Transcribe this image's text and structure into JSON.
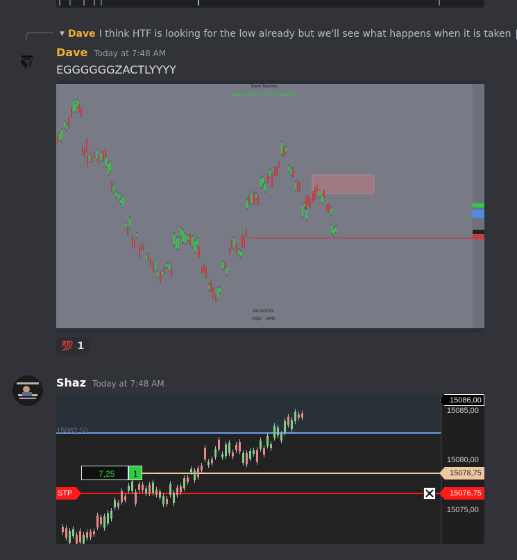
{
  "reply": {
    "author": "Dave",
    "text": "I think HTF is looking for the low already but we'll see what happens when it is taken",
    "image_icon": "image-icon"
  },
  "messages": [
    {
      "author": "Dave",
      "author_color": "#f0b232",
      "timestamp": "Today at 7:48 AM",
      "text": "EGGGGGGZACTLYYYY",
      "attachment": {
        "header": "Dave Teaches",
        "subheader": "Strategy: 4800R% · Net Profit: 31689.00%",
        "date_label": "19/10/2023",
        "symbol_label": "NQ1! · 1440",
        "chart_bg": "#787b86"
      },
      "reaction": {
        "emoji": "💯",
        "count": "1"
      }
    },
    {
      "author": "Shaz",
      "author_color": "#ffffff",
      "timestamp": "Today at 7:48 AM",
      "attachment": {
        "current_price": "15086,00",
        "axis_labels": [
          "15085,00",
          "15080,00",
          "15075,00"
        ],
        "position_price": "15078,75",
        "stop_price": "15076,75",
        "stop_label": "STP",
        "faded_price": "15082,50",
        "position_value": "7,25",
        "position_qty": "1",
        "colors": {
          "blue_line": "#6d9ee8",
          "position_line": "#f0c8a0",
          "stop_line": "#ff1a1a",
          "up": "#7fcf8a",
          "down": "#e88a8a"
        }
      }
    }
  ]
}
